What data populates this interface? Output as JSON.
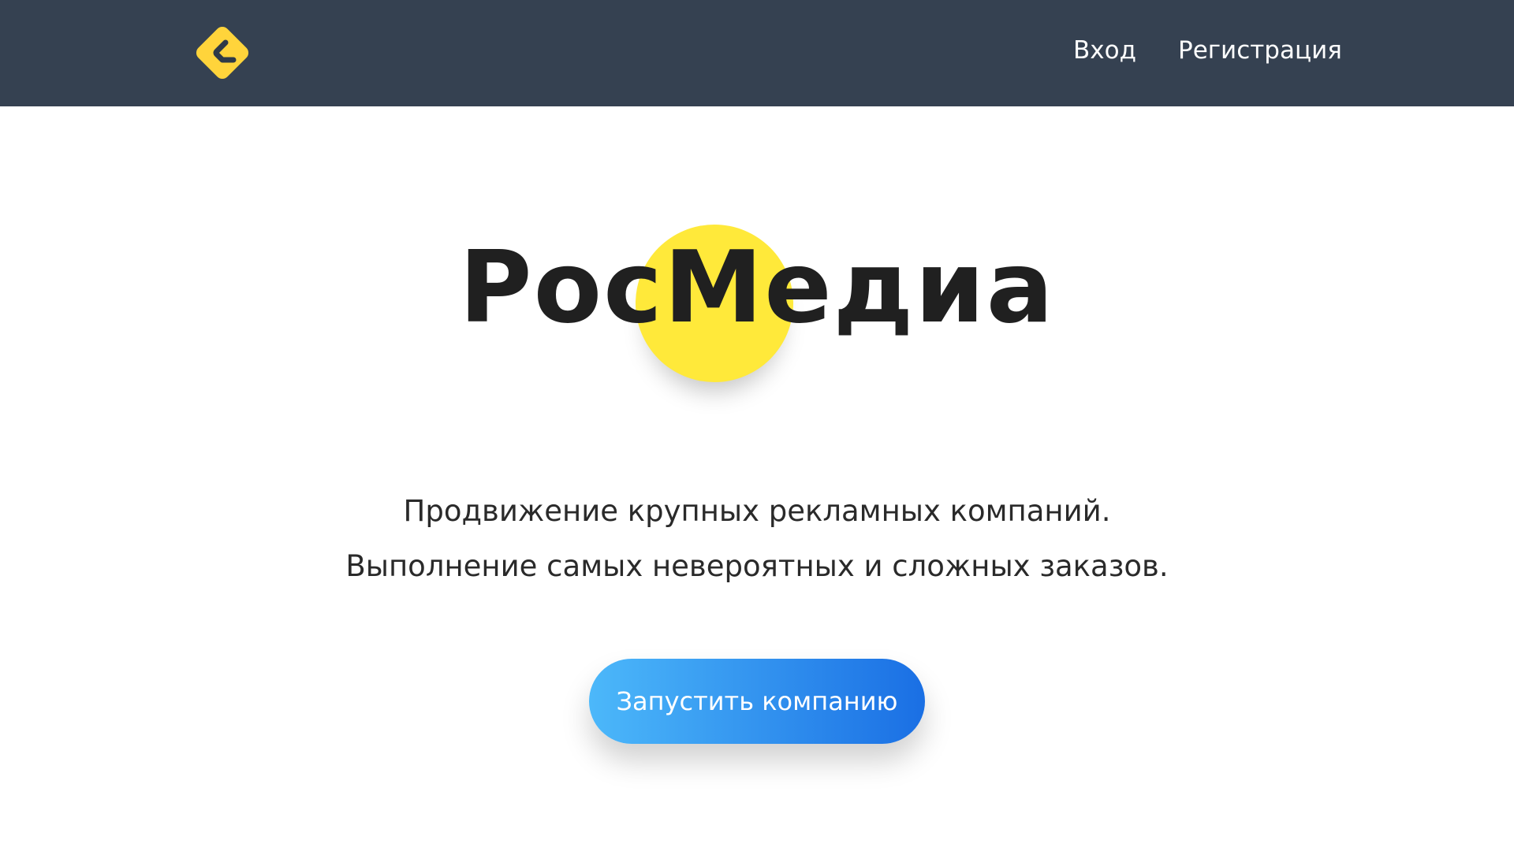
{
  "header": {
    "logo_icon": "brand-logo-icon",
    "logo_color": "#ffd43b",
    "background": "#354151",
    "nav": {
      "login_label": "Вход",
      "register_label": "Регистрация"
    }
  },
  "hero": {
    "title": "РосМедиа",
    "accent_color": "#ffe93a",
    "subtitle_line1": "Продвижение крупных рекламных компаний.",
    "subtitle_line2": "Выполнение самых невероятных и сложных заказов.",
    "cta_label": "Запустить компанию",
    "cta_gradient": [
      "#4cb8fa",
      "#1a6fe4"
    ]
  }
}
